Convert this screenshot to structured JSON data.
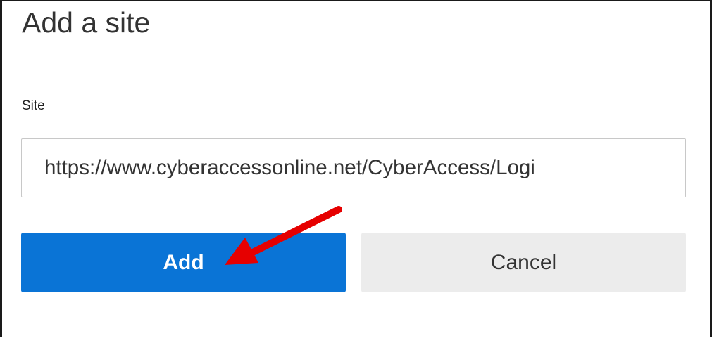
{
  "dialog": {
    "title": "Add a site",
    "site_label": "Site",
    "site_value": "https://www.cyberaccessonline.net/CyberAccess/Logi",
    "add_label": "Add",
    "cancel_label": "Cancel"
  },
  "colors": {
    "primary": "#0a74d6",
    "secondary_button": "#ececec",
    "annotation_arrow": "#e60000"
  },
  "icons": {
    "annotation": "red-arrow-icon"
  }
}
